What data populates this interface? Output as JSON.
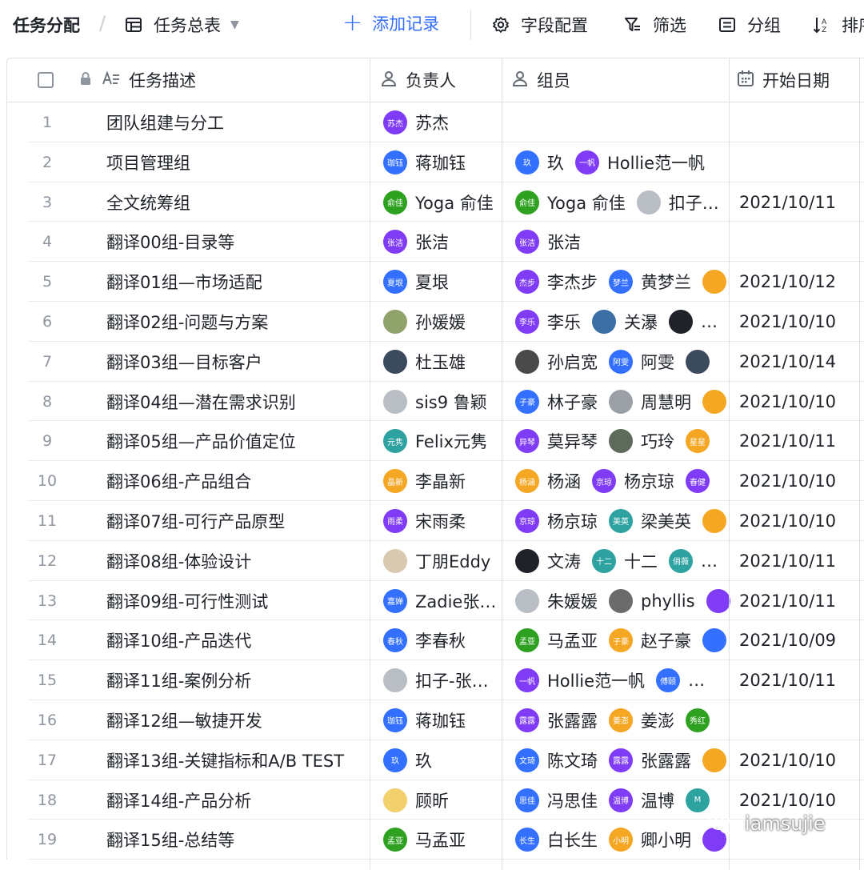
{
  "toolbar": {
    "title": "任务分配",
    "separator": "/",
    "view_name": "任务总表",
    "add_record": "添加记录",
    "field_config": "字段配置",
    "filter": "筛选",
    "group": "分组",
    "sort": "排序",
    "accent_color": "#3370ff"
  },
  "columns": {
    "description": "任务描述",
    "owner": "负责人",
    "members": "组员",
    "start_date": "开始日期"
  },
  "rows": [
    {
      "num": "1",
      "desc": "团队组建与分工",
      "owner": {
        "n": "苏杰",
        "a": "苏杰",
        "c": "#7f3bf5"
      },
      "members": [],
      "date": ""
    },
    {
      "num": "2",
      "desc": "项目管理组",
      "owner": {
        "n": "蒋珈钰",
        "a": "珈钰",
        "c": "#3370ff"
      },
      "members": [
        {
          "n": "玖",
          "a": "玖",
          "c": "#3370ff"
        },
        {
          "n": "Hollie范一帆",
          "a": "一帆",
          "c": "#7f3bf5"
        }
      ],
      "date": ""
    },
    {
      "num": "3",
      "desc": "全文统筹组",
      "owner": {
        "n": "Yoga 俞佳",
        "a": "俞佳",
        "c": "#2ea121"
      },
      "members": [
        {
          "n": "Yoga 俞佳",
          "a": "俞佳",
          "c": "#2ea121"
        },
        {
          "n": "扣子…",
          "a": "",
          "c": "#b9bdc4"
        }
      ],
      "date": "2021/10/11"
    },
    {
      "num": "4",
      "desc": "翻译00组-目录等",
      "owner": {
        "n": "张洁",
        "a": "张洁",
        "c": "#7f3bf5"
      },
      "members": [
        {
          "n": "张洁",
          "a": "张洁",
          "c": "#7f3bf5"
        }
      ],
      "date": ""
    },
    {
      "num": "5",
      "desc": "翻译01组—市场适配",
      "owner": {
        "n": "夏垠",
        "a": "夏垠",
        "c": "#3370ff"
      },
      "members": [
        {
          "n": "李杰步",
          "a": "杰步",
          "c": "#7f3bf5"
        },
        {
          "n": "黄梦兰",
          "a": "梦兰",
          "c": "#3370ff"
        },
        {
          "n": "",
          "a": "",
          "c": "#f5a623"
        }
      ],
      "date": "2021/10/12"
    },
    {
      "num": "6",
      "desc": "翻译02组-问题与方案",
      "owner": {
        "n": "孙媛媛",
        "a": "",
        "c": "#8fa36b"
      },
      "members": [
        {
          "n": "李乐",
          "a": "李乐",
          "c": "#7f3bf5"
        },
        {
          "n": "关瀑",
          "a": "",
          "c": "#3a6ea5"
        },
        {
          "n": "…",
          "a": "",
          "c": "#1f2329"
        }
      ],
      "date": "2021/10/10"
    },
    {
      "num": "7",
      "desc": "翻译03组—目标客户",
      "owner": {
        "n": "杜玉雄",
        "a": "",
        "c": "#3b4a5c"
      },
      "members": [
        {
          "n": "孙启宽",
          "a": "",
          "c": "#4a4a4a"
        },
        {
          "n": "阿雯",
          "a": "阿雯",
          "c": "#3370ff"
        },
        {
          "n": "",
          "a": "",
          "c": "#3b4a5c"
        }
      ],
      "date": "2021/10/14"
    },
    {
      "num": "8",
      "desc": "翻译04组—潜在需求识别",
      "owner": {
        "n": "sis9 鲁颖",
        "a": "",
        "c": "#b9bdc4"
      },
      "members": [
        {
          "n": "林子豪",
          "a": "子豪",
          "c": "#3370ff"
        },
        {
          "n": "周慧明",
          "a": "",
          "c": "#9aa0a6"
        },
        {
          "n": "",
          "a": "",
          "c": "#f5a623"
        }
      ],
      "date": "2021/10/10"
    },
    {
      "num": "9",
      "desc": "翻译05组—产品价值定位",
      "owner": {
        "n": "Felix元隽",
        "a": "元隽",
        "c": "#2ea1a1"
      },
      "members": [
        {
          "n": "莫异琴",
          "a": "异琴",
          "c": "#7f3bf5"
        },
        {
          "n": "巧玲",
          "a": "",
          "c": "#5c6b5a"
        },
        {
          "n": "",
          "a": "星星",
          "c": "#f5a623"
        }
      ],
      "date": "2021/10/11"
    },
    {
      "num": "10",
      "desc": "翻译06组-产品组合",
      "owner": {
        "n": "李晶新",
        "a": "晶新",
        "c": "#f5a623"
      },
      "members": [
        {
          "n": "杨涵",
          "a": "杨涵",
          "c": "#f5a623"
        },
        {
          "n": "杨京琼",
          "a": "京琼",
          "c": "#7f3bf5"
        },
        {
          "n": "",
          "a": "春健",
          "c": "#7f3bf5"
        }
      ],
      "date": "2021/10/10"
    },
    {
      "num": "11",
      "desc": "翻译07组-可行产品原型",
      "owner": {
        "n": "宋雨柔",
        "a": "雨柔",
        "c": "#7f3bf5"
      },
      "members": [
        {
          "n": "杨京琼",
          "a": "京琼",
          "c": "#7f3bf5"
        },
        {
          "n": "梁美英",
          "a": "美英",
          "c": "#2ea1a1"
        },
        {
          "n": "",
          "a": "",
          "c": "#f5a623"
        }
      ],
      "date": "2021/10/10"
    },
    {
      "num": "12",
      "desc": "翻译08组-体验设计",
      "owner": {
        "n": "丁朋Eddy",
        "a": "",
        "c": "#d8c9b0"
      },
      "members": [
        {
          "n": "文涛",
          "a": "",
          "c": "#1f2329"
        },
        {
          "n": "十二",
          "a": "十二",
          "c": "#2ea1a1"
        },
        {
          "n": "…",
          "a": "俏薇",
          "c": "#2ea1a1"
        }
      ],
      "date": "2021/10/11"
    },
    {
      "num": "13",
      "desc": "翻译09组-可行性测试",
      "owner": {
        "n": "Zadie张…",
        "a": "嘉婵",
        "c": "#3370ff"
      },
      "members": [
        {
          "n": "朱媛媛",
          "a": "",
          "c": "#b9bdc4"
        },
        {
          "n": "phyllis",
          "a": "",
          "c": "#6b6b6b"
        },
        {
          "n": "",
          "a": "",
          "c": "#7f3bf5"
        }
      ],
      "date": "2021/10/11"
    },
    {
      "num": "14",
      "desc": "翻译10组-产品迭代",
      "owner": {
        "n": "李春秋",
        "a": "春秋",
        "c": "#3370ff"
      },
      "members": [
        {
          "n": "马孟亚",
          "a": "孟亚",
          "c": "#2ea121"
        },
        {
          "n": "赵子豪",
          "a": "子豪",
          "c": "#f5a623"
        },
        {
          "n": "",
          "a": "",
          "c": "#3370ff"
        }
      ],
      "date": "2021/10/09"
    },
    {
      "num": "15",
      "desc": "翻译11组-案例分析",
      "owner": {
        "n": "扣子-张…",
        "a": "",
        "c": "#b9bdc4"
      },
      "members": [
        {
          "n": "Hollie范一帆",
          "a": "一帆",
          "c": "#7f3bf5"
        },
        {
          "n": "…",
          "a": "傅颐",
          "c": "#3370ff"
        }
      ],
      "date": "2021/10/11"
    },
    {
      "num": "16",
      "desc": "翻译12组—敏捷开发",
      "owner": {
        "n": "蒋珈钰",
        "a": "珈钰",
        "c": "#3370ff"
      },
      "members": [
        {
          "n": "张露露",
          "a": "露露",
          "c": "#7f3bf5"
        },
        {
          "n": "姜澎",
          "a": "姜澎",
          "c": "#f5a623"
        },
        {
          "n": "",
          "a": "秀红",
          "c": "#2ea121"
        }
      ],
      "date": ""
    },
    {
      "num": "17",
      "desc": "翻译13组-关键指标和A/B TEST",
      "owner": {
        "n": "玖",
        "a": "玖",
        "c": "#3370ff"
      },
      "members": [
        {
          "n": "陈文琦",
          "a": "文琦",
          "c": "#3370ff"
        },
        {
          "n": "张露露",
          "a": "露露",
          "c": "#7f3bf5"
        },
        {
          "n": "",
          "a": "",
          "c": "#f5a623"
        }
      ],
      "date": "2021/10/10"
    },
    {
      "num": "18",
      "desc": "翻译14组-产品分析",
      "owner": {
        "n": "顾昕",
        "a": "",
        "c": "#f2d06b"
      },
      "members": [
        {
          "n": "冯思佳",
          "a": "思佳",
          "c": "#3370ff"
        },
        {
          "n": "温博",
          "a": "温博",
          "c": "#7f3bf5"
        },
        {
          "n": "",
          "a": "M",
          "c": "#2ea1a1"
        }
      ],
      "date": "2021/10/10"
    },
    {
      "num": "19",
      "desc": "翻译15组-总结等",
      "owner": {
        "n": "马孟亚",
        "a": "孟亚",
        "c": "#2ea121"
      },
      "members": [
        {
          "n": "白长生",
          "a": "长生",
          "c": "#3370ff"
        },
        {
          "n": "卿小明",
          "a": "小明",
          "c": "#f5a623"
        },
        {
          "n": "",
          "a": "",
          "c": "#7f3bf5"
        }
      ],
      "date": ""
    }
  ],
  "watermark": "iamsujie"
}
